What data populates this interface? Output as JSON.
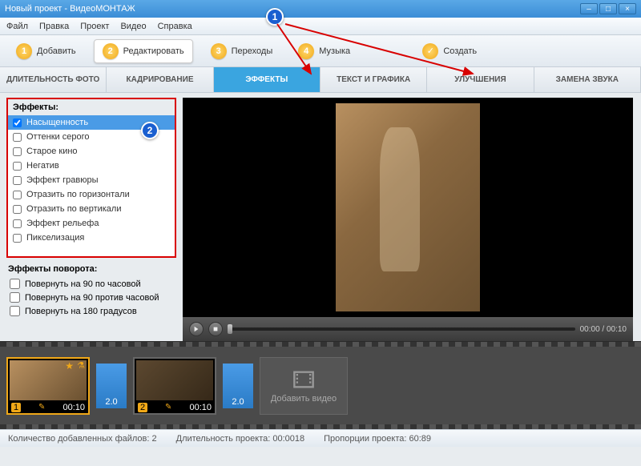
{
  "window": {
    "title": "Новый проект - ВидеоМОНТАЖ"
  },
  "menu": {
    "file": "Файл",
    "edit": "Правка",
    "project": "Проект",
    "video": "Видео",
    "help": "Справка"
  },
  "toolbar": {
    "add": "Добавить",
    "edit": "Редактировать",
    "transitions": "Переходы",
    "music": "Музыка",
    "create": "Создать",
    "n1": "1",
    "n2": "2",
    "n3": "3",
    "n4": "4"
  },
  "subtabs": {
    "duration": "ДЛИТЕЛЬНОСТЬ ФОТО",
    "crop": "КАДРИРОВАНИЕ",
    "effects": "ЭФФЕКТЫ",
    "text": "ТЕКСТ И ГРАФИКА",
    "enhance": "УЛУЧШЕНИЯ",
    "audio": "ЗАМЕНА ЗВУКА"
  },
  "effects": {
    "header": "Эффекты:",
    "items": [
      "Насыщенность",
      "Оттенки серого",
      "Старое кино",
      "Негатив",
      "Эффект гравюры",
      "Отразить по горизонтали",
      "Отразить по вертикали",
      "Эффект рельефа",
      "Пикселизация"
    ],
    "rotation_header": "Эффекты поворота:",
    "rotation": [
      "Повернуть на 90 по часовой",
      "Повернуть на 90 против часовой",
      "Повернуть на 180 градусов"
    ]
  },
  "player": {
    "timecode": "00:00 / 00:10"
  },
  "timeline": {
    "clip1_n": "1",
    "clip1_t": "00:10",
    "trans1": "2.0",
    "clip2_n": "2",
    "clip2_t": "00:10",
    "trans2": "2.0",
    "add": "Добавить видео"
  },
  "status": {
    "files": "Количество добавленных файлов: 2",
    "duration": "Длительность проекта:   00:0018",
    "ratio": "Пропорции проекта:   60:89"
  },
  "annotations": {
    "c1": "1",
    "c2": "2"
  }
}
